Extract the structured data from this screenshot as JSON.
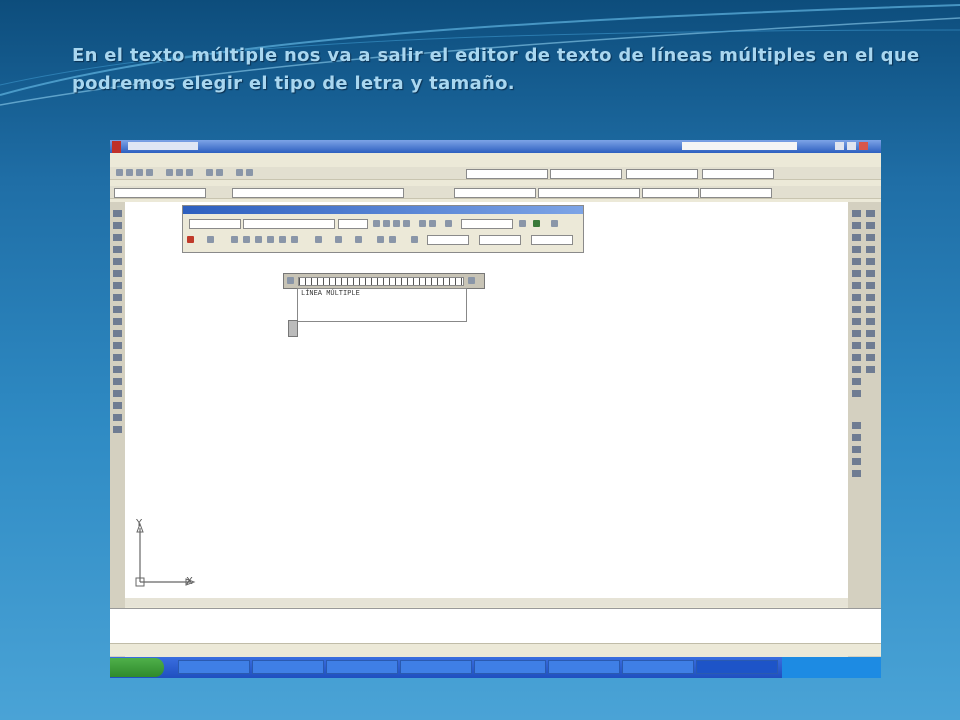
{
  "slide": {
    "title": "En el texto múltiple nos va a salir el editor de texto de líneas múltiples en el que podremos elegir el tipo de letra y tamaño."
  },
  "editor": {
    "text": "LÍNEA MÚLTIPLE"
  },
  "axes": {
    "y": "Y",
    "x": "X"
  },
  "colors": {
    "background_top": "#0d4d7c",
    "background_bottom": "#4aa3d6",
    "title_text": "#a9d7f0",
    "taskbar": "#1f4fbf",
    "start_button": "#2f8a2c"
  }
}
